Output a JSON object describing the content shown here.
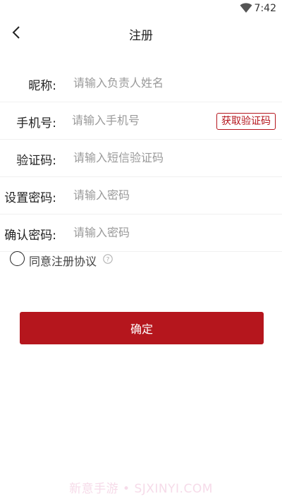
{
  "status_bar": {
    "time": "7:42",
    "wifi_icon": "wifi-icon"
  },
  "app_bar": {
    "title": "注册",
    "back_icon": "back-arrow-icon"
  },
  "form": {
    "nickname": {
      "label": "昵称:",
      "placeholder": "请输入负责人姓名",
      "value": ""
    },
    "phone": {
      "label": "手机号:",
      "placeholder": "请输入手机号",
      "value": "",
      "get_code_label": "获取验证码"
    },
    "code": {
      "label": "验证码:",
      "placeholder": "请输入短信验证码",
      "value": ""
    },
    "password": {
      "label": "设置密码:",
      "placeholder": "请输入密码",
      "value": ""
    },
    "confirm_password": {
      "label": "确认密码:",
      "placeholder": "请输入密码",
      "value": ""
    }
  },
  "agreement": {
    "label": "同意注册协议",
    "checked": false,
    "help_icon": "question-circle-icon"
  },
  "confirm_button": {
    "label": "确定"
  },
  "watermark": {
    "text": "新意手游 • SJXINYI.COM"
  },
  "colors": {
    "accent": "#b5161d",
    "background": "#ffffff",
    "placeholder": "#9a9a9a"
  }
}
